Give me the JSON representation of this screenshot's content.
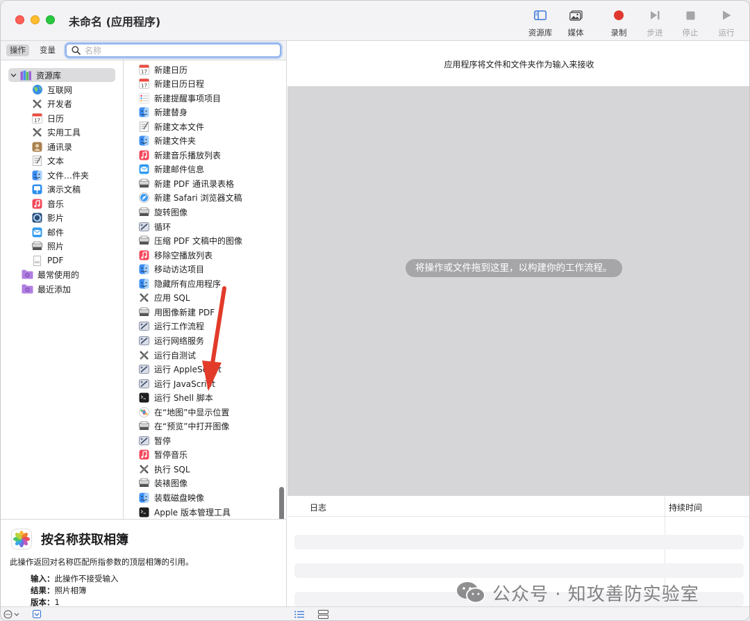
{
  "window": {
    "title": "未命名 (应用程序)"
  },
  "toolbar": {
    "library": "资源库",
    "media": "媒体",
    "record": "录制",
    "step": "步进",
    "stop": "停止",
    "run": "运行"
  },
  "search": {
    "tab_actions": "操作",
    "tab_variables": "变量",
    "placeholder": "名称"
  },
  "library": {
    "root": "资源库",
    "items": [
      "互联网",
      "开发者",
      "日历",
      "实用工具",
      "通讯录",
      "文本",
      "文件…件夹",
      "演示文稿",
      "音乐",
      "影片",
      "邮件",
      "照片",
      "PDF"
    ],
    "smart": [
      "最常使用的",
      "最近添加"
    ]
  },
  "actions": [
    "新建日历",
    "新建日历日程",
    "新建提醒事项项目",
    "新建替身",
    "新建文本文件",
    "新建文件夹",
    "新建音乐播放列表",
    "新建邮件信息",
    "新建 PDF 通讯录表格",
    "新建 Safari 浏览器文稿",
    "旋转图像",
    "循环",
    "压缩 PDF 文稿中的图像",
    "移除空播放列表",
    "移动访达项目",
    "隐藏所有应用程序",
    "应用 SQL",
    "用图像新建 PDF",
    "运行工作流程",
    "运行网络服务",
    "运行自测试",
    "运行 AppleScript",
    "运行 JavaScript",
    "运行 Shell 脚本",
    "在“地图”中显示位置",
    "在“预览”中打开图像",
    "暂停",
    "暂停音乐",
    "执行 SQL",
    "装裱图像",
    "装载磁盘映像",
    "Apple 版本管理工具"
  ],
  "description": {
    "title": "按名称获取相簿",
    "text": "此操作返回对名称匹配所指参数的顶层相簿的引用。",
    "input_label": "输入：",
    "input_value": "此操作不接受输入",
    "result_label": "结果：",
    "result_value": "照片相簿",
    "version_label": "版本：",
    "version_value": "1"
  },
  "workflow": {
    "header": "应用程序将文件和文件夹作为输入来接收",
    "hint": "将操作或文件拖到这里，以构建你的工作流程。"
  },
  "log": {
    "col_log": "日志",
    "col_duration": "持续时间"
  },
  "watermark": "公众号 · 知攻善防实验室",
  "colors": {
    "record": "#e0382f",
    "accent": "#2a6fd6",
    "arrow": "#e23b2a"
  }
}
